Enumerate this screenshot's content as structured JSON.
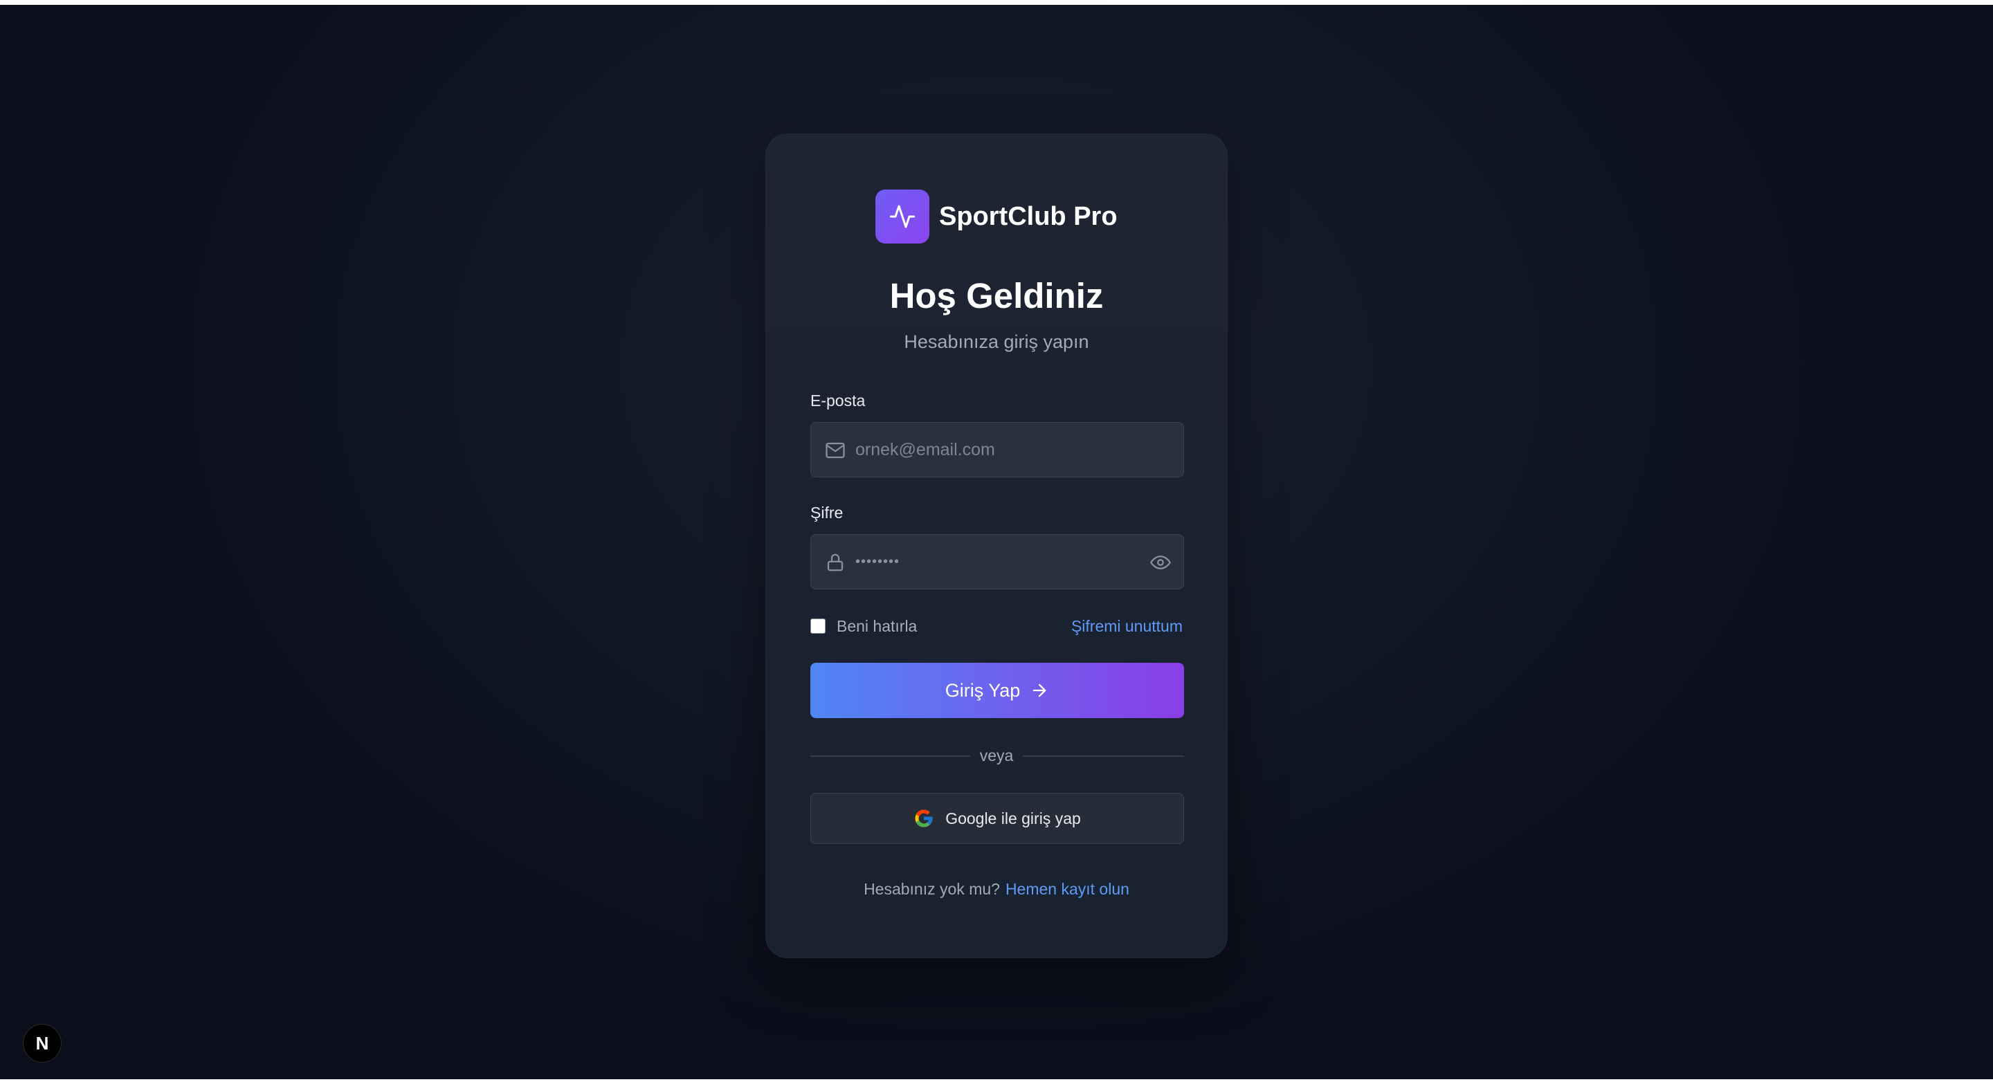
{
  "app": {
    "name": "SportClub Pro"
  },
  "login": {
    "title": "Hoş Geldiniz",
    "subtitle": "Hesabınıza giriş yapın",
    "email": {
      "label": "E-posta",
      "placeholder": "ornek@email.com",
      "value": ""
    },
    "password": {
      "label": "Şifre",
      "placeholder": "••••••••",
      "value": ""
    },
    "remember_label": "Beni hatırla",
    "remember_checked": false,
    "forgot_label": "Şifremi unuttum",
    "submit_label": "Giriş Yap",
    "divider_label": "veya",
    "google_label": "Google ile giriş yap",
    "signup_prompt": "Hesabınız yok mu?",
    "signup_link": "Hemen kayıt olun"
  },
  "dev_badge": {
    "letter": "N"
  },
  "icons": {
    "brand": "activity-icon",
    "email": "mail-icon",
    "password": "lock-icon",
    "toggle_password": "eye-icon",
    "submit": "arrow-right-icon",
    "google": "google-icon"
  },
  "colors": {
    "accent_start": "#4f86f4",
    "accent_end": "#8a3ee6",
    "link": "#5f9bf5",
    "background": "#0f1420",
    "card": "#1c2330"
  }
}
